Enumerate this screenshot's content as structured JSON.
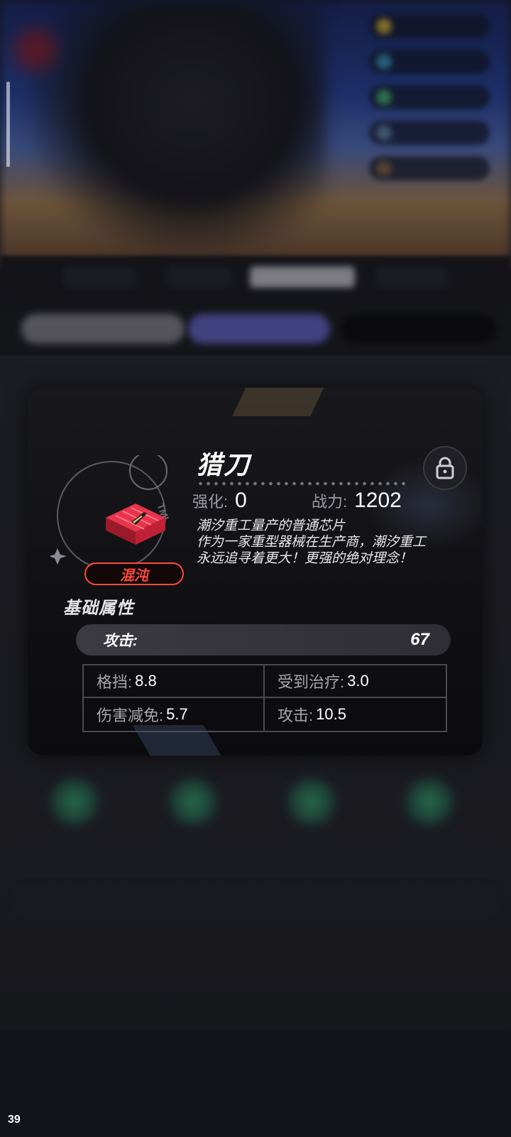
{
  "disc": {
    "name": "猎刀",
    "enhance_label": "强化:",
    "enhance_value": "0",
    "power_label": "战力:",
    "power_value": "1202",
    "description_lines": [
      "潮汐重工量产的普通芯片",
      "作为一家重型器械在生产商，潮汐重工",
      "永远追寻着更大！更强的绝对理念！"
    ],
    "faction": "混沌",
    "lock_icon": "lock-icon"
  },
  "attributes": {
    "title": "基础属性",
    "main": {
      "label": "攻击:",
      "value": "67"
    },
    "sub": [
      {
        "label": "格挡:",
        "value": "8.8"
      },
      {
        "label": "受到治疗:",
        "value": "3.0"
      },
      {
        "label": "伤害减免:",
        "value": "5.7"
      },
      {
        "label": "攻击:",
        "value": "10.5"
      }
    ]
  },
  "overlay": {
    "corner_number": "39"
  },
  "colors": {
    "faction_accent": "#ff4a3d",
    "panel_bg": "#111114"
  }
}
